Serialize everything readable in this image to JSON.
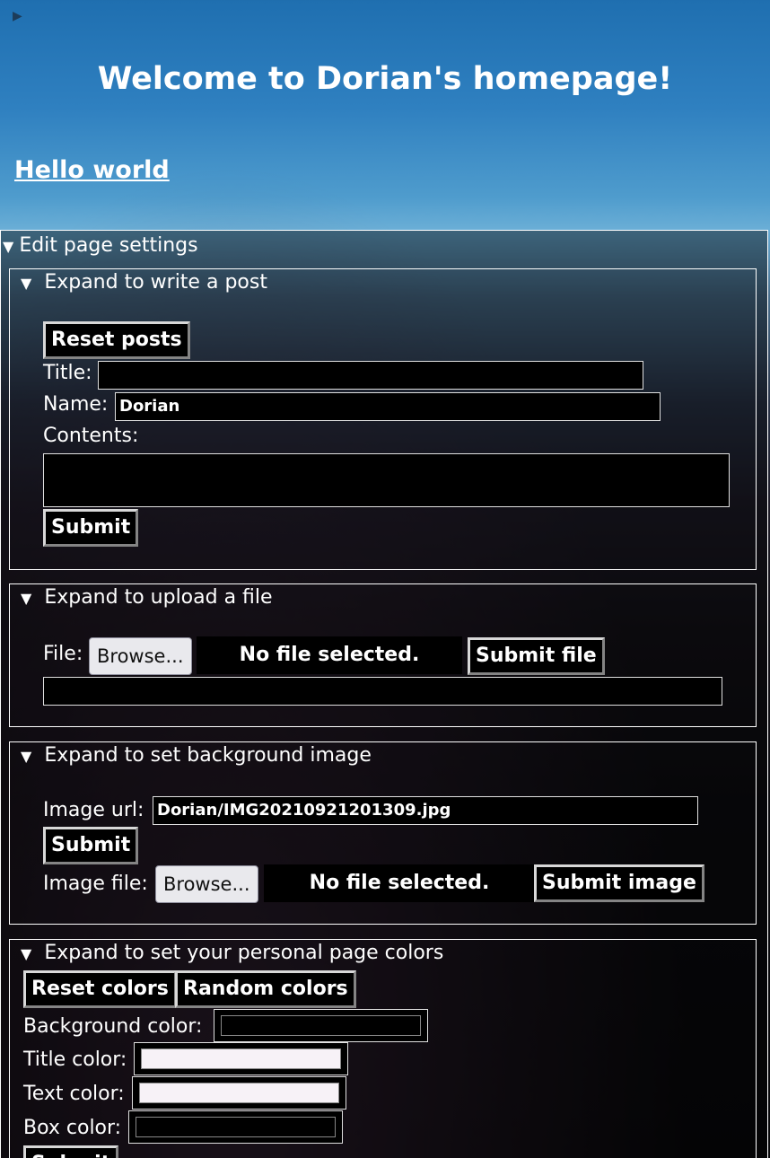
{
  "page": {
    "title": "Welcome to Dorian's homepage!",
    "hello_link": "Hello world",
    "top_toggle_icon": "triangle-right-icon"
  },
  "settings": {
    "summary": "Edit page settings"
  },
  "post_panel": {
    "summary": "Expand to write a post",
    "reset_label": "Reset posts",
    "title_label": "Title:",
    "title_value": "",
    "name_label": "Name:",
    "name_value": "Dorian",
    "contents_label": "Contents:",
    "contents_value": "",
    "submit_label": "Submit"
  },
  "upload_panel": {
    "summary": "Expand to upload a file",
    "file_label": "File:",
    "browse_label": "Browse...",
    "no_file_text": "No file selected.",
    "submit_label": "Submit file",
    "result_value": ""
  },
  "background_panel": {
    "summary": "Expand to set background image",
    "url_label": "Image url:",
    "url_value": "Dorian/IMG20210921201309.jpg",
    "submit_label": "Submit",
    "file_label": "Image file:",
    "browse_label": "Browse...",
    "no_file_text": "No file selected.",
    "submit_image_label": "Submit image"
  },
  "colors_panel": {
    "summary": "Expand to set your personal page colors",
    "reset_label": "Reset colors",
    "random_label": "Random colors",
    "background_label": "Background color:",
    "background_value": "#000000",
    "title_label": "Title color:",
    "title_value": "#f7f2f7",
    "text_label": "Text color:",
    "text_value": "#f7f2f7",
    "box_label": "Box color:",
    "box_value": "#000000",
    "submit_label": "Submit"
  },
  "colors": {
    "button_bg": "#000000",
    "text": "#ffffff",
    "sky_top": "#1f6fb0",
    "sky_bottom": "#6aaed6"
  }
}
